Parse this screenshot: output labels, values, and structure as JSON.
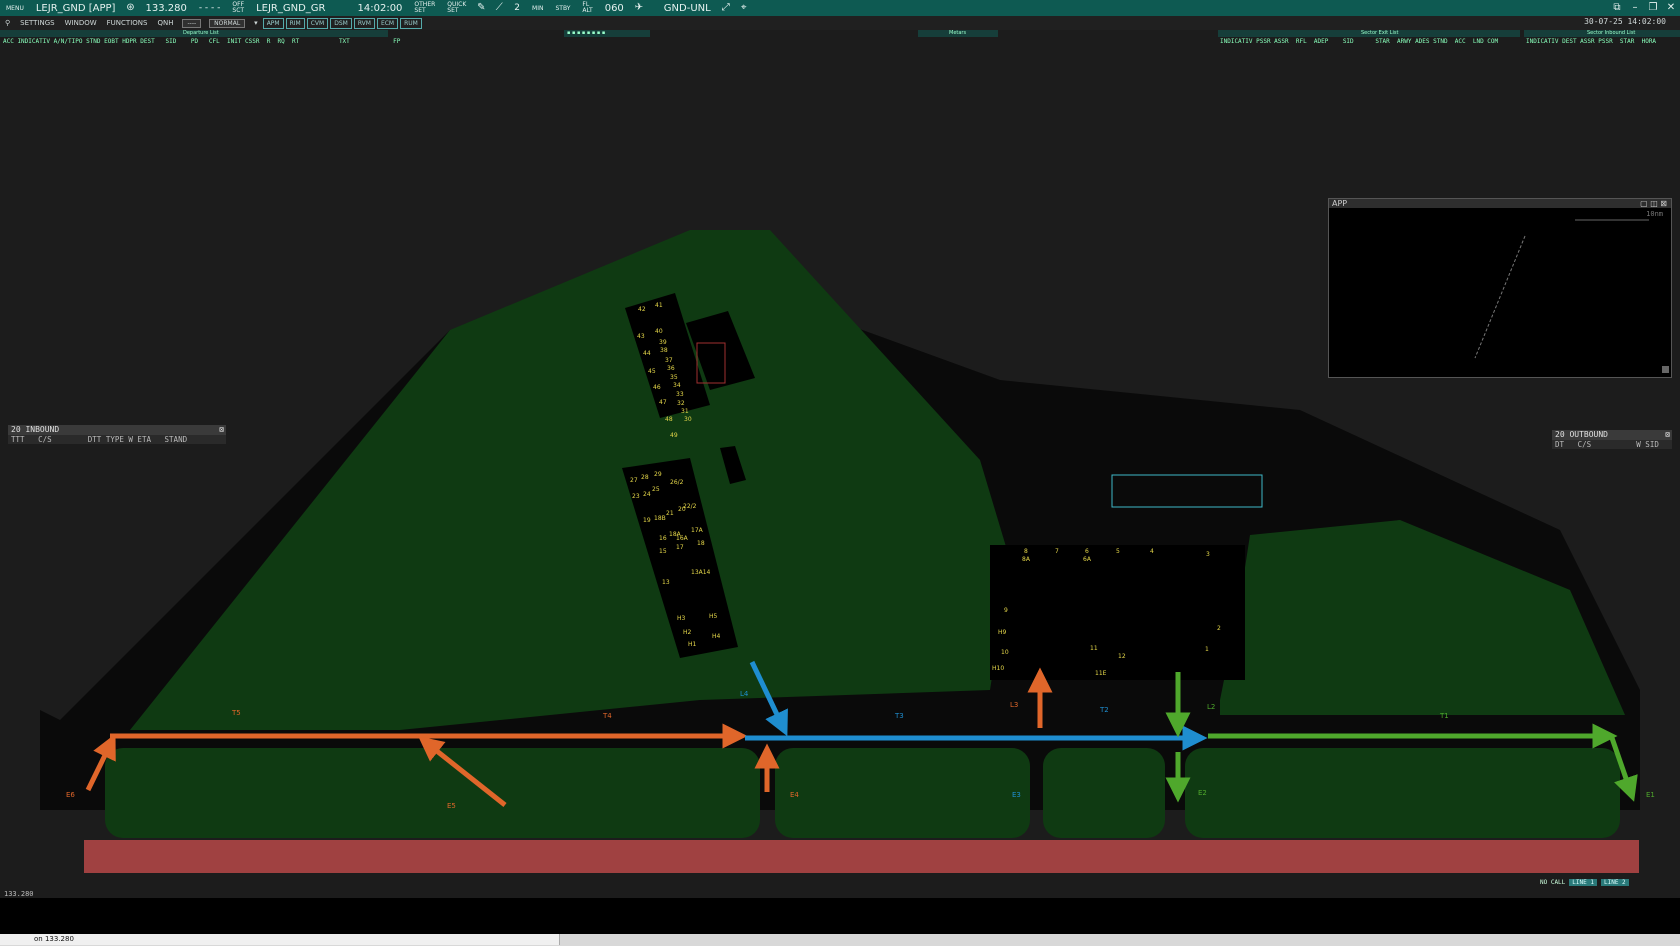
{
  "topbar": {
    "mode": "MENU",
    "callsign": "LEJR_GND [APP]",
    "freq": "133.280",
    "dashes": "- - - -",
    "offline": "OFF",
    "sct": "SCT",
    "sector": "LEJR_GND_GR",
    "time": "14:02:00",
    "other": "OTHER",
    "quick": "QUICK",
    "set1": "SET",
    "set2": "SET",
    "minutes": "2",
    "min_label": "MIN",
    "stby": "STBY",
    "fl": "FL",
    "alt": "ALT",
    "fl_value": "060",
    "unl": "GND-UNL"
  },
  "menubar": {
    "settings": "SETTINGS",
    "window": "WINDOW",
    "functions": "FUNCTIONS",
    "qnh": "QNH",
    "qnh_value": "----",
    "mode": "NORMAL",
    "tools": [
      "APM",
      "RIM",
      "CVM",
      "DSM",
      "RVM",
      "ECM",
      "RUM"
    ]
  },
  "datetime": "30-07-25 14:02:00",
  "lists": {
    "departure": {
      "title": "Departure List",
      "columns": "ACC INDICATIV A/N/TIPO STND EOBT HDPR DEST   SID    PD   CFL  INIT CSSR  R  RQ  RT           TXT            FP"
    },
    "sector_exit": {
      "title": "Sector Exit List",
      "columns": "INDICATIV PSSR ASSR  RFL  ADEP    SID      STAR  ARWY ADES STND  ACC  LND COM"
    },
    "sector_inbound": {
      "title": "Sector Inbound List",
      "columns": "INDICATIV DEST ASSR PSSR  STAR  HORA"
    },
    "metars": {
      "title": "Metars"
    }
  },
  "inbound_panel": {
    "title": "20 INBOUND",
    "columns": "TTT   C/S        DTT TYPE W ETA   STAND"
  },
  "outbound_panel": {
    "title": "20 OUTBOUND",
    "columns": "DT   C/S          W SID"
  },
  "app_window": {
    "title": "APP",
    "scale": "10nm"
  },
  "stands": {
    "north": [
      "41",
      "42",
      "40",
      "43",
      "39",
      "38",
      "44",
      "37",
      "36",
      "45",
      "35",
      "46",
      "34",
      "33",
      "47",
      "32",
      "31",
      "48",
      "30",
      "49"
    ],
    "mid": [
      "29",
      "27",
      "28",
      "26/2",
      "25",
      "23",
      "24",
      "22/2",
      "21",
      "20",
      "19",
      "18B",
      "17A",
      "18A",
      "16A",
      "16",
      "17",
      "18",
      "15",
      "13A14",
      "13"
    ],
    "south": [
      "H3",
      "H5",
      "H2",
      "H4",
      "H1"
    ],
    "east": [
      "8",
      "7",
      "6",
      "5",
      "4",
      "3",
      "8A",
      "6A",
      "9",
      "H9",
      "2",
      "1",
      "10",
      "11",
      "12",
      "H10",
      "11E"
    ]
  },
  "taxiways": {
    "T": [
      "T5",
      "T4",
      "T3",
      "T2",
      "T1"
    ],
    "L": [
      "L4",
      "L3",
      "L2"
    ],
    "E": [
      "E6",
      "E5",
      "E4",
      "E3",
      "E2",
      "E1"
    ]
  },
  "footer": {
    "freq": "133.280",
    "input": "on 133.280",
    "nocall": "NO CALL",
    "line1": "LINE 1",
    "line2": "LINE 2"
  },
  "colors": {
    "grass": "#0f3a12",
    "apron": "#000000",
    "runway": "#a04141",
    "orange": "#e0662a",
    "blue": "#1f8ed0",
    "green": "#4fa82c",
    "stand_text": "#e6d84a"
  }
}
